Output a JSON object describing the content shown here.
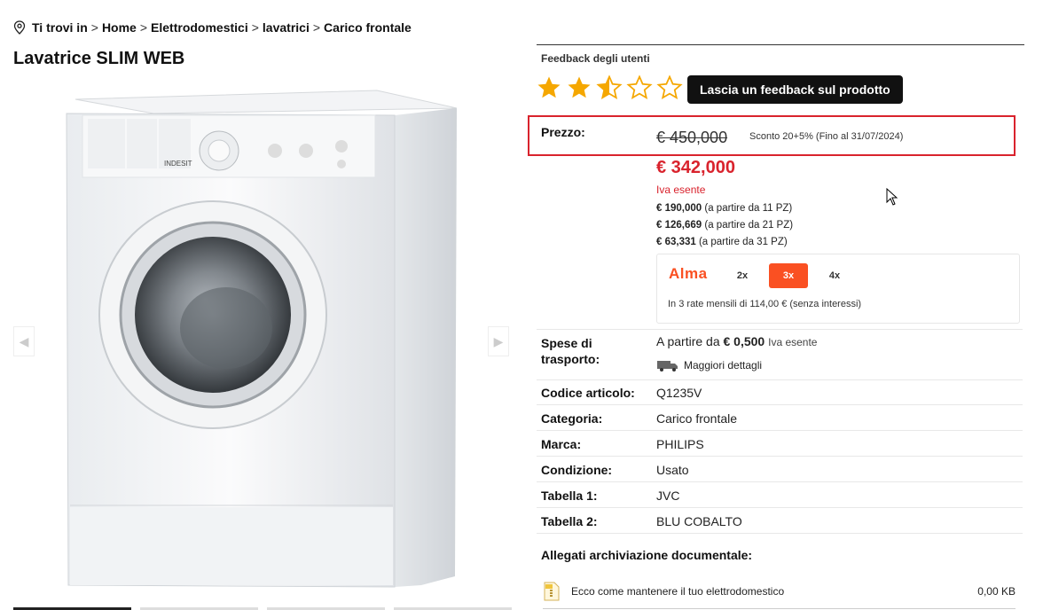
{
  "breadcrumb": {
    "prefix": "Ti trovi in",
    "items": [
      "Home",
      "Elettrodomestici",
      "lavatrici",
      "Carico frontale"
    ],
    "separator": ">"
  },
  "product": {
    "title": "Lavatrice SLIM WEB"
  },
  "feedback": {
    "label": "Feedback degli utenti",
    "rating": 2.5,
    "max_rating": 5,
    "button_label": "Lascia un feedback sul prodotto"
  },
  "price": {
    "label": "Prezzo:",
    "old_price": "€ 450,000",
    "discount_note": "Sconto 20+5% (Fino al 31/07/2024)",
    "new_price": "€ 342,000",
    "vat_note": "Iva esente",
    "tiers": [
      {
        "price": "€ 190,000",
        "note": "(a partire da 11 PZ)"
      },
      {
        "price": "€ 126,669",
        "note": "(a partire da 21 PZ)"
      },
      {
        "price": "€ 63,331",
        "note": "(a partire da 31 PZ)"
      }
    ]
  },
  "alma": {
    "logo": "Alma",
    "options": [
      "2x",
      "3x",
      "4x"
    ],
    "selected": "3x",
    "installment_text": "In 3 rate mensili di 114,00 € (senza interessi)"
  },
  "shipping": {
    "label": "Spese di trasporto:",
    "prefix": "A partire da",
    "amount": "€ 0,500",
    "vat_note": "Iva esente",
    "details_link": "Maggiori dettagli"
  },
  "specs": [
    {
      "label": "Codice articolo:",
      "value": "Q1235V"
    },
    {
      "label": "Categoria:",
      "value": "Carico frontale"
    },
    {
      "label": "Marca:",
      "value": "PHILIPS"
    },
    {
      "label": "Condizione:",
      "value": "Usato"
    },
    {
      "label": "Tabella 1:",
      "value": "JVC"
    },
    {
      "label": "Tabella 2:",
      "value": "BLU COBALTO"
    }
  ],
  "attachments": {
    "title": "Allegati archiviazione documentale:",
    "files": [
      {
        "name": "Ecco come mantenere il tuo elettrodomestico",
        "size": "0,00 KB"
      }
    ]
  },
  "gallery": {
    "brand_on_product": "INDESIT",
    "thumbnail_count": 4,
    "active_thumbnail": 0
  },
  "colors": {
    "accent_red": "#d9232d",
    "alma_orange": "#fa5022",
    "star_gold": "#f5a700"
  }
}
